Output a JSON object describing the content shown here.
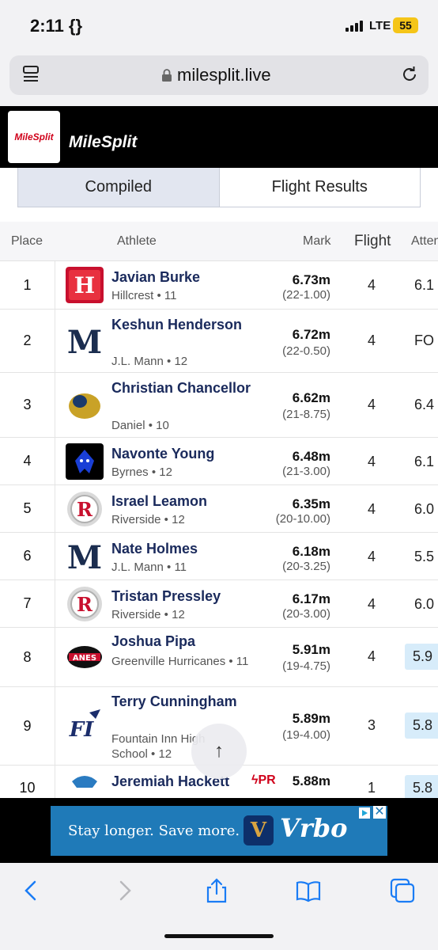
{
  "status_bar": {
    "time": "2:11 {}",
    "network": "LTE",
    "battery": "55"
  },
  "browser": {
    "url": "milesplit.live"
  },
  "site": {
    "logo_text": "MileSplit",
    "brand": "MileSplit"
  },
  "tabs": [
    {
      "label": "Compiled",
      "active": true
    },
    {
      "label": "Flight Results",
      "active": false
    }
  ],
  "table": {
    "headers": {
      "place": "Place",
      "athlete": "Athlete",
      "mark": "Mark",
      "flight": "Flight",
      "attempt": "Atten"
    },
    "rows": [
      {
        "place": "1",
        "name": "Javian Burke",
        "school": "Hillcrest • 11",
        "mark": "6.73m",
        "mark_sub": "(22-1.00)",
        "flight": "4",
        "attempt": "6.1",
        "logo": "hillcrest-logo"
      },
      {
        "place": "2",
        "name": "Keshun Henderson",
        "school": "J.L. Mann • 12",
        "mark": "6.72m",
        "mark_sub": "(22-0.50)",
        "flight": "4",
        "attempt": "FO",
        "logo": "jl-mann-logo"
      },
      {
        "place": "3",
        "name": "Christian Chancellor",
        "school": "Daniel • 10",
        "mark": "6.62m",
        "mark_sub": "(21-8.75)",
        "flight": "4",
        "attempt": "6.4",
        "logo": "daniel-logo"
      },
      {
        "place": "4",
        "name": "Navonte Young",
        "school": "Byrnes • 12",
        "mark": "6.48m",
        "mark_sub": "(21-3.00)",
        "flight": "4",
        "attempt": "6.1",
        "logo": "byrnes-logo"
      },
      {
        "place": "5",
        "name": "Israel Leamon",
        "school": "Riverside • 12",
        "mark": "6.35m",
        "mark_sub": "(20-10.00)",
        "flight": "4",
        "attempt": "6.0",
        "logo": "riverside-logo"
      },
      {
        "place": "6",
        "name": "Nate Holmes",
        "school": "J.L. Mann • 11",
        "mark": "6.18m",
        "mark_sub": "(20-3.25)",
        "flight": "4",
        "attempt": "5.5",
        "logo": "jl-mann-logo"
      },
      {
        "place": "7",
        "name": "Tristan Pressley",
        "school": "Riverside • 12",
        "mark": "6.17m",
        "mark_sub": "(20-3.00)",
        "flight": "4",
        "attempt": "6.0",
        "logo": "riverside-logo"
      },
      {
        "place": "8",
        "name": "Joshua Pipa",
        "school": "Greenville Hurricanes • 11",
        "mark": "5.91m",
        "mark_sub": "(19-4.75)",
        "flight": "4",
        "attempt": "5.9",
        "logo": "greenville-logo"
      },
      {
        "place": "9",
        "name": "Terry Cunningham",
        "school": "Fountain Inn High School • 12",
        "mark": "5.89m",
        "mark_sub": "(19-4.00)",
        "flight": "3",
        "attempt": "5.8",
        "logo": "fountain-inn-logo"
      },
      {
        "place": "10",
        "name": "Jeremiah Hackett",
        "school": "",
        "mark": "5.88m",
        "mark_sub": "",
        "flight": "1",
        "attempt": "5.8",
        "pr": "PR",
        "logo": "wildcats-logo"
      }
    ]
  },
  "ad": {
    "text": "Stay longer. Save more.",
    "brand": "Vrbo",
    "close": "✕"
  },
  "colors": {
    "header_bg": "#000000",
    "name_color": "#1a2a5c",
    "pr_color": "#d0021b",
    "highlight": "#d7ecfa",
    "ad_bg": "#1f7ab8"
  }
}
